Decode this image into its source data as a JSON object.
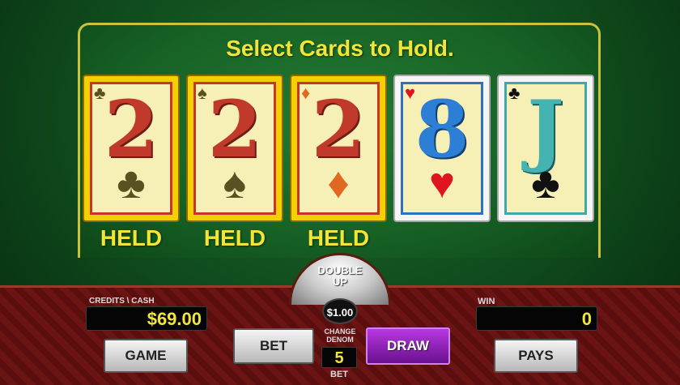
{
  "prompt": "Select Cards to Hold.",
  "cards": [
    {
      "rank": "2",
      "suit": "♣",
      "held": true,
      "held_label": "HELD"
    },
    {
      "rank": "2",
      "suit": "♠",
      "held": true,
      "held_label": "HELD"
    },
    {
      "rank": "2",
      "suit": "♦",
      "held": true,
      "held_label": "HELD"
    },
    {
      "rank": "8",
      "suit": "♥",
      "held": false,
      "held_label": ""
    },
    {
      "rank": "J",
      "suit": "♣",
      "held": false,
      "held_label": ""
    }
  ],
  "double_up": {
    "line1": "DOUBLE",
    "line2": "UP"
  },
  "credits": {
    "label": "CREDITS \\ CASH",
    "value": "$69.00"
  },
  "win": {
    "label": "WIN",
    "value": "0"
  },
  "denomination": {
    "value": "$1.00",
    "label": "CHANGE DENOM"
  },
  "bet": {
    "value": "5",
    "label": "BET"
  },
  "buttons": {
    "game": "GAME",
    "bet": "BET",
    "draw": "DRAW",
    "pays": "PAYS"
  },
  "colors": {
    "felt": "#176125",
    "prompt": "#f2e53a",
    "held_border": "#f4d000",
    "draw_button": "#8a20b8"
  }
}
